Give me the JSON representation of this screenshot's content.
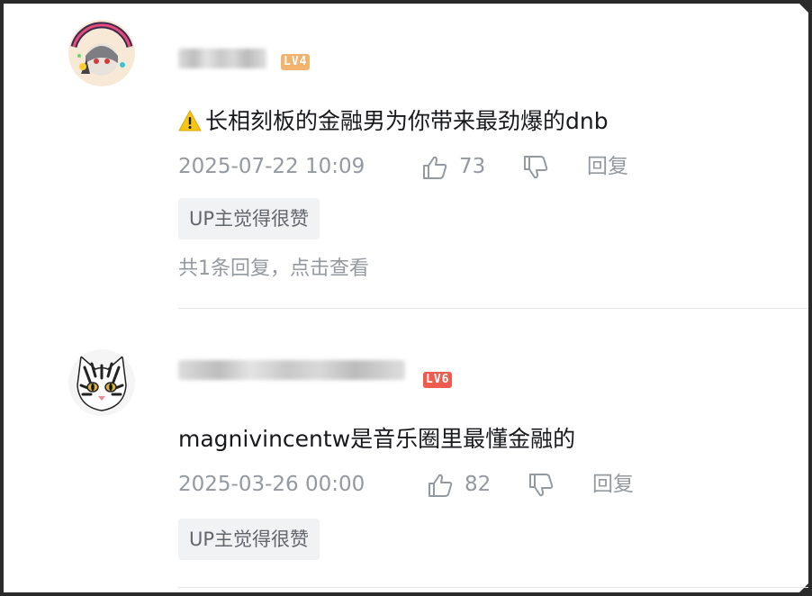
{
  "comments": [
    {
      "level": "LV4",
      "text": "长相刻板的金融男为你带来最劲爆的dnb",
      "date": "2025-07-22 10:09",
      "likes": "73",
      "reply_label": "回复",
      "up_badge": "UP主觉得很赞",
      "replies_link": "共1条回复，点击查看",
      "has_warning_icon": true,
      "badge_color": "#f2b36e"
    },
    {
      "level": "LV6",
      "text": "magnivincentw是音乐圈里最懂金融的",
      "date": "2025-03-26 00:00",
      "likes": "82",
      "reply_label": "回复",
      "up_badge": "UP主觉得很赞",
      "badge_color": "#ee5b4f"
    }
  ],
  "colors": {
    "text": "#18191c",
    "meta": "#9499a0",
    "badge_bg": "#f1f2f3"
  },
  "icons": [
    "warning-icon",
    "thumb-up-icon",
    "thumb-down-icon"
  ]
}
